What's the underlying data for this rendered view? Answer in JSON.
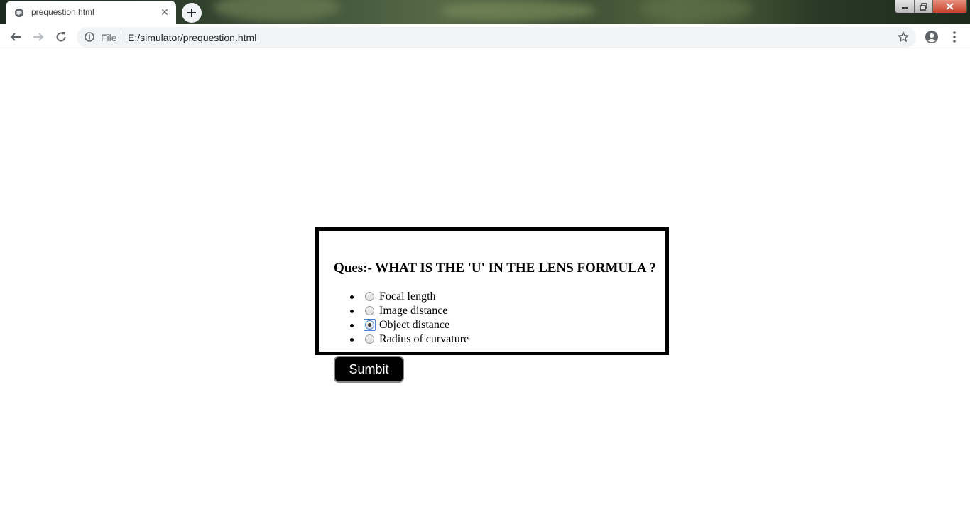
{
  "browser": {
    "tab": {
      "title": "prequestion.html",
      "close_glyph": "✕"
    },
    "new_tab_glyph": "+",
    "omnibox": {
      "scheme_label": "File",
      "url": "E:/simulator/prequestion.html"
    },
    "window_controls": [
      "minimize",
      "restore",
      "close"
    ],
    "icons": [
      "globe-icon",
      "back-arrow-icon",
      "forward-arrow-icon",
      "reload-icon",
      "info-icon",
      "star-icon",
      "profile-icon",
      "kebab-menu-icon"
    ]
  },
  "quiz": {
    "question": "Ques:- WHAT IS THE 'U' IN THE LENS FORMULA ?",
    "options": [
      {
        "label": "Focal length",
        "checked": false
      },
      {
        "label": "Image distance",
        "checked": false
      },
      {
        "label": "Object distance",
        "checked": true
      },
      {
        "label": "Radius of curvature",
        "checked": false
      }
    ],
    "submit_label": "Sumbit"
  },
  "colors": {
    "box_border": "#000000",
    "button_bg": "#000000",
    "button_text": "#ffffff"
  }
}
